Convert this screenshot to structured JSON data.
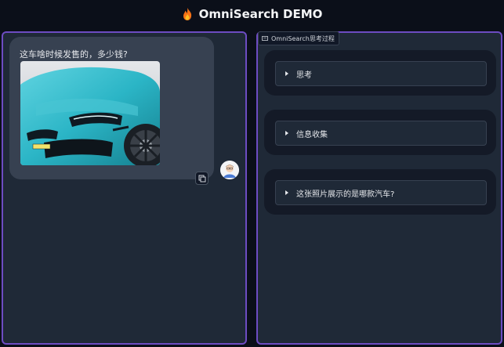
{
  "app": {
    "title": "OmniSearch DEMO"
  },
  "chat": {
    "user_message": "这车啥时候发售的，多少钱?"
  },
  "thinking_panel": {
    "label": "OmniSearch思考过程",
    "steps": [
      {
        "label": "思考"
      },
      {
        "label": "信息收集"
      },
      {
        "label": "这张照片展示的是哪款汽车?"
      }
    ]
  },
  "colors": {
    "panel_border": "#6d4cc2",
    "panel_bg": "#1f2937",
    "page_bg": "#0b0f19",
    "car_teal": "#2bb5c6"
  }
}
